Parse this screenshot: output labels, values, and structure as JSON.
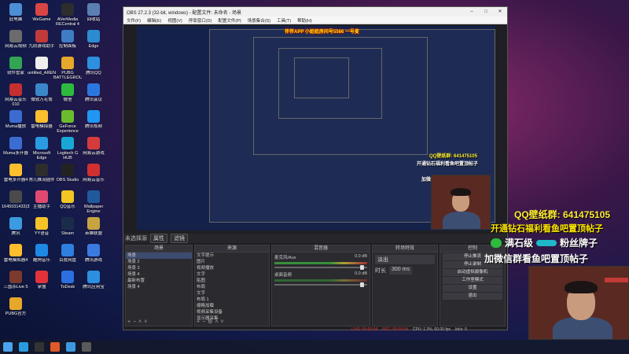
{
  "desktop": {
    "icons": [
      {
        "label": "此电脑",
        "color": "#4d8fd6"
      },
      {
        "label": "WeGame",
        "color": "#d84545"
      },
      {
        "label": "AVerMedia RECentral 4",
        "color": "#2d2d2d"
      },
      {
        "label": "回收站",
        "color": "#5b7fb0"
      },
      {
        "label": "网易云视频",
        "color": "#6b6b6b"
      },
      {
        "label": "九阴游戏助手",
        "color": "#c23a3a"
      },
      {
        "label": "控制面板",
        "color": "#3e7cc4"
      },
      {
        "label": "Edge",
        "color": "#2d8bd1"
      },
      {
        "label": "软件管家",
        "color": "#33a354"
      },
      {
        "label": "untitled_ARENA14",
        "color": "#eeeeee"
      },
      {
        "label": "PUBG BATTLEGROUNDS",
        "color": "#e6a82a"
      },
      {
        "label": "腾讯QQ",
        "color": "#2c8fe0"
      },
      {
        "label": "网易云音乐 010",
        "color": "#c52f2f"
      },
      {
        "label": "微软万花筒",
        "color": "#3a88c9"
      },
      {
        "label": "微信",
        "color": "#2dba3d"
      },
      {
        "label": "腾讯会议",
        "color": "#2c76e0"
      },
      {
        "label": "Muma播放",
        "color": "#3b6dd1"
      },
      {
        "label": "雷电模拟器",
        "color": "#ffbe2e"
      },
      {
        "label": "GeForce Experience",
        "color": "#6abb2d"
      },
      {
        "label": "腾讯视频",
        "color": "#2196f3"
      },
      {
        "label": "Muma多开器",
        "color": "#3b6dd1"
      },
      {
        "label": "Microsoft Edge",
        "color": "#2a9be0"
      },
      {
        "label": "Logitech G HUB",
        "color": "#19a8d6"
      },
      {
        "label": "网易云游戏",
        "color": "#d53b3b"
      },
      {
        "label": "雷电多开器4",
        "color": "#ffbe2e"
      },
      {
        "label": "秀儿推流插件",
        "color": "#2d2d2d"
      },
      {
        "label": "OBS Studio",
        "color": "#222222"
      },
      {
        "label": "网易云音乐",
        "color": "#d03030"
      },
      {
        "label": "1645031433(3)",
        "color": "#4a4a4a"
      },
      {
        "label": "主播助手",
        "color": "#e04a70"
      },
      {
        "label": "QQ音乐",
        "color": "#f2c623"
      },
      {
        "label": "Wallpaper Engine",
        "color": "#1f5b9c"
      },
      {
        "label": "腾讯",
        "color": "#3c9be0"
      },
      {
        "label": "YY语音",
        "color": "#f5c22a"
      },
      {
        "label": "Steam",
        "color": "#1b2c4a"
      },
      {
        "label": "英雄联盟",
        "color": "#c7a440"
      },
      {
        "label": "雷电模拟器4",
        "color": "#ffbe2e"
      },
      {
        "label": "酷狗音乐",
        "color": "#1e88e5"
      },
      {
        "label": "百度网盘",
        "color": "#2f7fe0"
      },
      {
        "label": "腾讯游戏",
        "color": "#3b7be0"
      },
      {
        "label": "三国杀Live 5",
        "color": "#7c3a2e"
      },
      {
        "label": "掌盟",
        "color": "#e0343a"
      },
      {
        "label": "ToDesk",
        "color": "#2b6fe0"
      },
      {
        "label": "腾讯应用宝",
        "color": "#2c8fe0"
      },
      {
        "label": "PUBG官方",
        "color": "#e6a82a"
      }
    ]
  },
  "obs": {
    "title": "OBS 27.2.3 (32-bit, windows) - 配置文件: 未命名 - 场景",
    "menu": [
      "文件(F)",
      "编辑(E)",
      "视图(V)",
      "停靠窗口(D)",
      "配置文件(P)",
      "场景集合(S)",
      "工具(T)",
      "帮助(H)"
    ],
    "scene_name": "未选择源",
    "scene_btns": [
      "属性",
      "滤镜"
    ],
    "docks": {
      "scenes": {
        "title": "场景",
        "items": [
          "场景",
          "场景 2",
          "场景 3",
          "场景 4",
          "最新布置",
          "场景 4"
        ]
      },
      "sources": {
        "title": "来源",
        "items": [
          "文字提示",
          "图片",
          "视频播放",
          "文字",
          "贴图",
          "布局",
          "文字",
          "布局 1",
          "缩略加载",
          "视频采集设备",
          "显示器采集"
        ]
      },
      "mixer": {
        "title": "混音器",
        "tracks": [
          {
            "name": "麦克风/Aux",
            "db": "0.0 dB"
          },
          {
            "name": "桌面音频",
            "db": "0.0 dB"
          }
        ]
      },
      "transitions": {
        "title": "转场特效",
        "value": "淡出",
        "duration_label": "时长",
        "duration": "300 ms"
      },
      "controls": {
        "title": "控制",
        "items": [
          "停止推流",
          "停止录制",
          "启动虚拟摄像机",
          "工作室模式",
          "设置",
          "退出"
        ]
      }
    },
    "status": {
      "live": "LIVE: 00:00:04",
      "rec": "REC: 00:00:04",
      "cpu": "CPU: 1.3%, 60.00 fps",
      "kbps": "kb/s: 0"
    }
  },
  "overlay": {
    "banner": "伴伴APP 小姐姐房间号5566 一号麦",
    "qq": "QQ壁纸群: 641475105",
    "vip_line1": "开通钻石福利看鱼吧置顶帖子",
    "vip_line2_a": "满石级",
    "vip_line2_b": "粉丝牌子",
    "vip_line3": "加微信群看鱼吧置顶帖子"
  },
  "taskbar": {
    "icons": [
      {
        "name": "start-icon",
        "color": "#4aa3f0"
      },
      {
        "name": "edge-task-icon",
        "color": "#2a9be0"
      },
      {
        "name": "obs-task-icon",
        "color": "#333333"
      },
      {
        "name": "browser-task-icon",
        "color": "#e05a2a"
      },
      {
        "name": "app-task-icon",
        "color": "#3c9be0"
      },
      {
        "name": "app2-task-icon",
        "color": "#5a5a5a"
      }
    ]
  }
}
